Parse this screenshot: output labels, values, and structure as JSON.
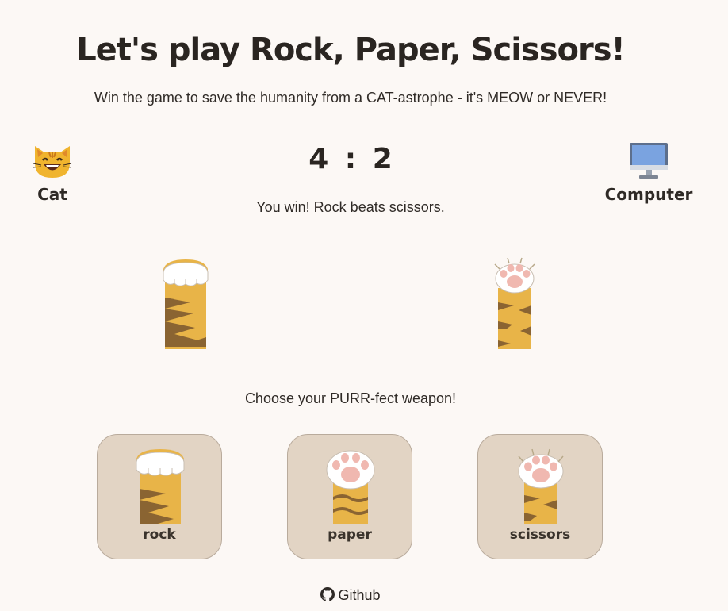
{
  "title": "Let's play Rock, Paper, Scissors!",
  "subtitle": "Win the game to save the humanity from a CAT-astrophe - it's MEOW or NEVER!",
  "players": {
    "cat": {
      "label": "Cat",
      "icon": "cat-face-icon"
    },
    "computer": {
      "label": "Computer",
      "icon": "desktop-computer-icon"
    }
  },
  "score": {
    "cat": 4,
    "separator": ":",
    "computer": 2
  },
  "result": "You win! Rock beats scissors.",
  "arena": {
    "cat_choice": "rock",
    "computer_choice": "scissors"
  },
  "prompt": "Choose your PURR-fect weapon!",
  "weapons": [
    {
      "label": "rock",
      "icon": "rock-paw-icon"
    },
    {
      "label": "paper",
      "icon": "paper-paw-icon"
    },
    {
      "label": "scissors",
      "icon": "scissors-paw-icon"
    }
  ],
  "footer": {
    "link_label": "Github",
    "icon": "github-icon"
  },
  "colors": {
    "background": "#fcf8f5",
    "card": "#e2d4c4",
    "fur": "#e8b448",
    "stripe": "#8a6432"
  }
}
